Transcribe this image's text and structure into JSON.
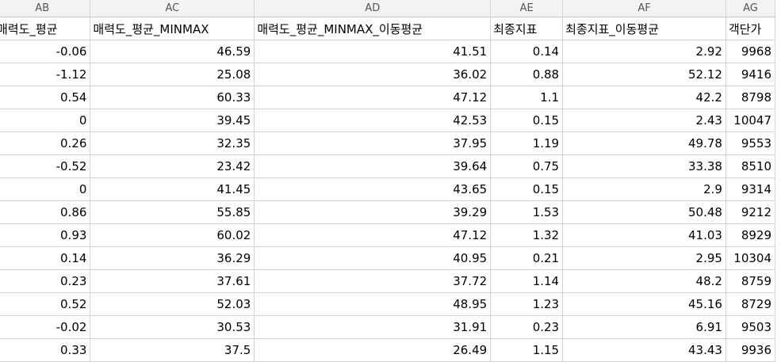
{
  "columns": [
    "AB",
    "AC",
    "AD",
    "AE",
    "AF",
    "AG"
  ],
  "header_row": [
    "매력도_평균",
    "매력도_평균_MINMAX",
    "매력도_평균_MINMAX_이동평균",
    "최종지표",
    "최종지표_이동평균",
    "객단가"
  ],
  "rows": [
    [
      "-0.06",
      "46.59",
      "41.51",
      "0.14",
      "2.92",
      "9968"
    ],
    [
      "-1.12",
      "25.08",
      "36.02",
      "0.88",
      "52.12",
      "9416"
    ],
    [
      "0.54",
      "60.33",
      "47.12",
      "1.1",
      "42.2",
      "8798"
    ],
    [
      "0",
      "39.45",
      "42.53",
      "0.15",
      "2.43",
      "10047"
    ],
    [
      "0.26",
      "32.35",
      "37.95",
      "1.19",
      "49.78",
      "9553"
    ],
    [
      "-0.52",
      "23.42",
      "39.64",
      "0.75",
      "33.38",
      "8510"
    ],
    [
      "0",
      "41.45",
      "43.65",
      "0.15",
      "2.9",
      "9314"
    ],
    [
      "0.86",
      "55.85",
      "39.29",
      "1.53",
      "50.48",
      "9212"
    ],
    [
      "0.93",
      "60.02",
      "47.12",
      "1.32",
      "41.03",
      "8929"
    ],
    [
      "0.14",
      "36.29",
      "40.95",
      "0.21",
      "2.95",
      "10304"
    ],
    [
      "0.23",
      "37.61",
      "37.72",
      "1.14",
      "48.2",
      "8759"
    ],
    [
      "0.52",
      "52.03",
      "48.95",
      "1.23",
      "45.16",
      "8729"
    ],
    [
      "-0.02",
      "30.53",
      "31.91",
      "0.23",
      "6.91",
      "9503"
    ],
    [
      "0.33",
      "37.5",
      "26.49",
      "1.15",
      "43.43",
      "9936"
    ]
  ]
}
